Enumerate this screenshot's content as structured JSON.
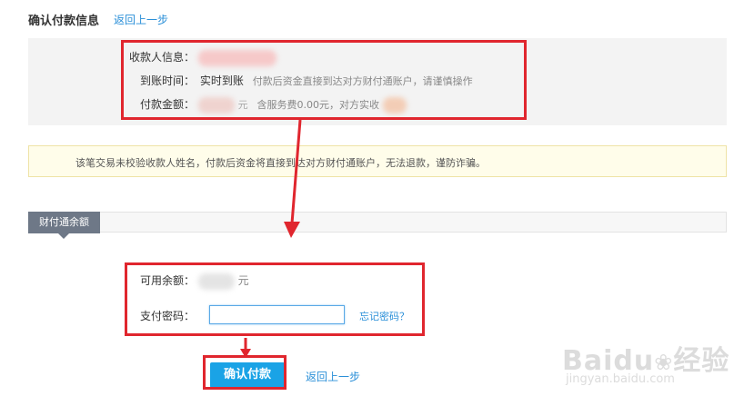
{
  "header": {
    "title": "确认付款信息",
    "back_link": "返回上一步"
  },
  "info": {
    "payee_label": "收款人信息：",
    "arrival_label": "到账时间：",
    "arrival_value": "实时到账",
    "arrival_note": "付款后资金直接到达对方财付通账户，请谨慎操作",
    "amount_label": "付款金额：",
    "amount_suffix": "元",
    "fee_text": "含服务费0.00元，对方实收"
  },
  "warning": {
    "text": "该笔交易未校验收款人姓名，付款后资金将直接到达对方财付通账户，无法退款，谨防诈骗。"
  },
  "balance": {
    "tab_label": "财付通余额",
    "available_label": "可用余额：",
    "available_suffix": "元",
    "password_label": "支付密码：",
    "password_value": "",
    "forgot_link": "忘记密码？"
  },
  "actions": {
    "confirm_label": "确认付款",
    "back_label": "返回上一步"
  },
  "watermark": {
    "brand": "Baidu",
    "brand_cn": "经验",
    "url": "jingyan.baidu.com"
  },
  "colors": {
    "accent": "#1aa3e6",
    "annotation_red": "#e0262e",
    "link": "#2a8fd8"
  }
}
